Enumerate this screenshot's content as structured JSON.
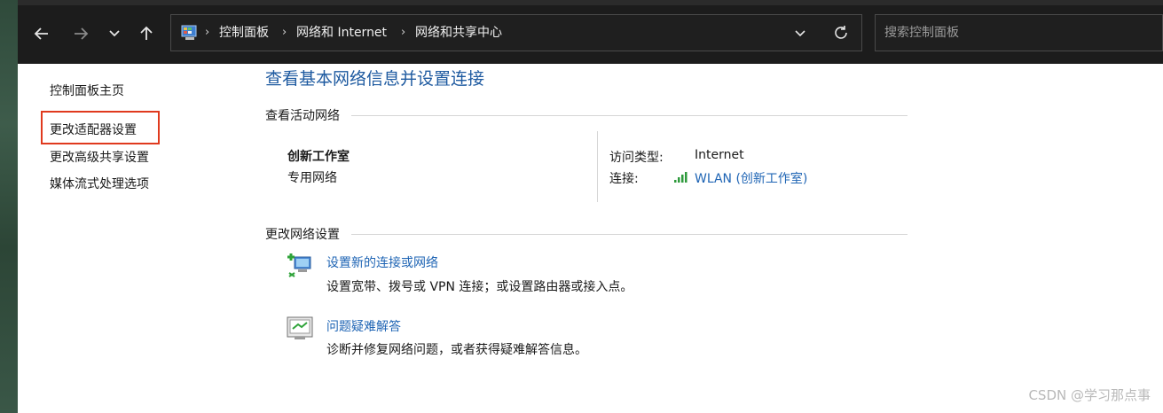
{
  "toolbar": {
    "breadcrumb": [
      "控制面板",
      "网络和 Internet",
      "网络和共享中心"
    ],
    "search_placeholder": "搜索控制面板"
  },
  "sidebar": {
    "items": [
      {
        "label": "控制面板主页"
      },
      {
        "label": "更改适配器设置"
      },
      {
        "label": "更改高级共享设置"
      },
      {
        "label": "媒体流式处理选项"
      }
    ]
  },
  "main": {
    "title": "查看基本网络信息并设置连接",
    "active_networks_heading": "查看活动网络",
    "network": {
      "name": "创新工作室",
      "type": "专用网络",
      "access_type_label": "访问类型:",
      "access_type_value": "Internet",
      "connection_label": "连接:",
      "connection_value": "WLAN (创新工作室)"
    },
    "change_settings_heading": "更改网络设置",
    "tasks": [
      {
        "title": "设置新的连接或网络",
        "description": "设置宽带、拨号或 VPN 连接；或设置路由器或接入点。",
        "icon": "network-setup-icon"
      },
      {
        "title": "问题疑难解答",
        "description": "诊断并修复网络问题，或者获得疑难解答信息。",
        "icon": "troubleshoot-icon"
      }
    ]
  },
  "watermark": "CSDN @学习那点事",
  "colors": {
    "accent": "#1e5aa0",
    "link": "#1e64b4",
    "highlight": "#e03a1e",
    "toolbar": "#1c1c1c"
  }
}
